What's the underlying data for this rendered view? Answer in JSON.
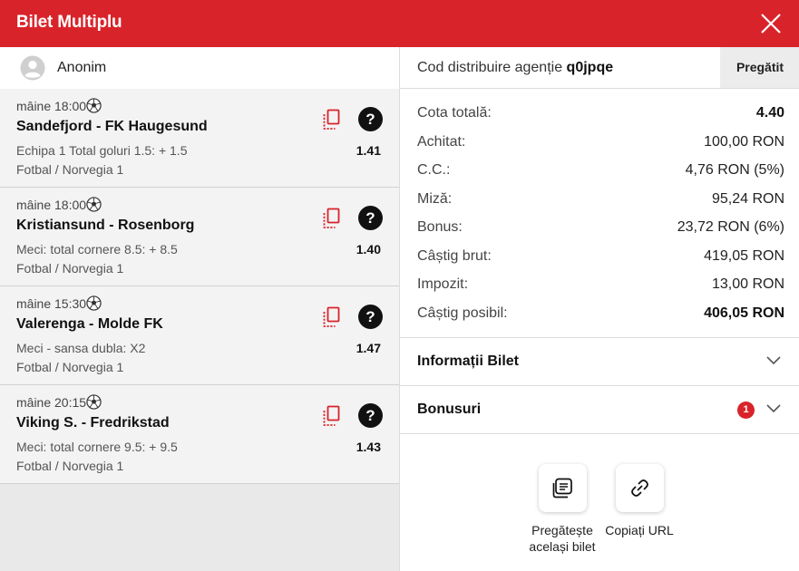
{
  "header": {
    "title": "Bilet Multiplu"
  },
  "user": {
    "name": "Anonim"
  },
  "code": {
    "label": "Cod distribuire agenție",
    "value": "q0jpqe",
    "prepare_label": "Pregătit"
  },
  "events": [
    {
      "time": "mâine 18:00",
      "match": "Sandefjord - FK Haugesund",
      "market": "Echipa 1 Total goluri 1.5: + 1.5",
      "league": "Fotbal / Norvegia 1",
      "odd": "1.41"
    },
    {
      "time": "mâine 18:00",
      "match": "Kristiansund - Rosenborg",
      "market": "Meci: total cornere 8.5: + 8.5",
      "league": "Fotbal / Norvegia 1",
      "odd": "1.40"
    },
    {
      "time": "mâine 15:30",
      "match": "Valerenga - Molde FK",
      "market": "Meci - sansa dubla: X2",
      "league": "Fotbal / Norvegia 1",
      "odd": "1.47"
    },
    {
      "time": "mâine 20:15",
      "match": "Viking S. - Fredrikstad",
      "market": "Meci: total cornere 9.5: + 9.5",
      "league": "Fotbal / Norvegia 1",
      "odd": "1.43"
    }
  ],
  "help_glyph": "?",
  "summary": {
    "total_odds": {
      "label": "Cota totală:",
      "value": "4.40"
    },
    "paid": {
      "label": "Achitat:",
      "value": "100,00 RON"
    },
    "cc": {
      "label": "C.C.:",
      "value": "4,76 RON (5%)"
    },
    "stake": {
      "label": "Miză:",
      "value": "95,24 RON"
    },
    "bonus": {
      "label": "Bonus:",
      "value": "23,72 RON (6%)"
    },
    "gross": {
      "label": "Câștig brut:",
      "value": "419,05 RON"
    },
    "tax": {
      "label": "Impozit:",
      "value": "13,00 RON"
    },
    "possible": {
      "label": "Câștig posibil:",
      "value": "406,05 RON"
    }
  },
  "accordions": {
    "info": {
      "label": "Informații Bilet"
    },
    "bonuses": {
      "label": "Bonusuri",
      "badge": "1"
    }
  },
  "actions": {
    "prepare_same": {
      "label": "Pregătește același bilet"
    },
    "copy_url": {
      "label": "Copiați URL"
    }
  },
  "colors": {
    "brand": "#d9232a",
    "panel": "#e9e9ea"
  }
}
